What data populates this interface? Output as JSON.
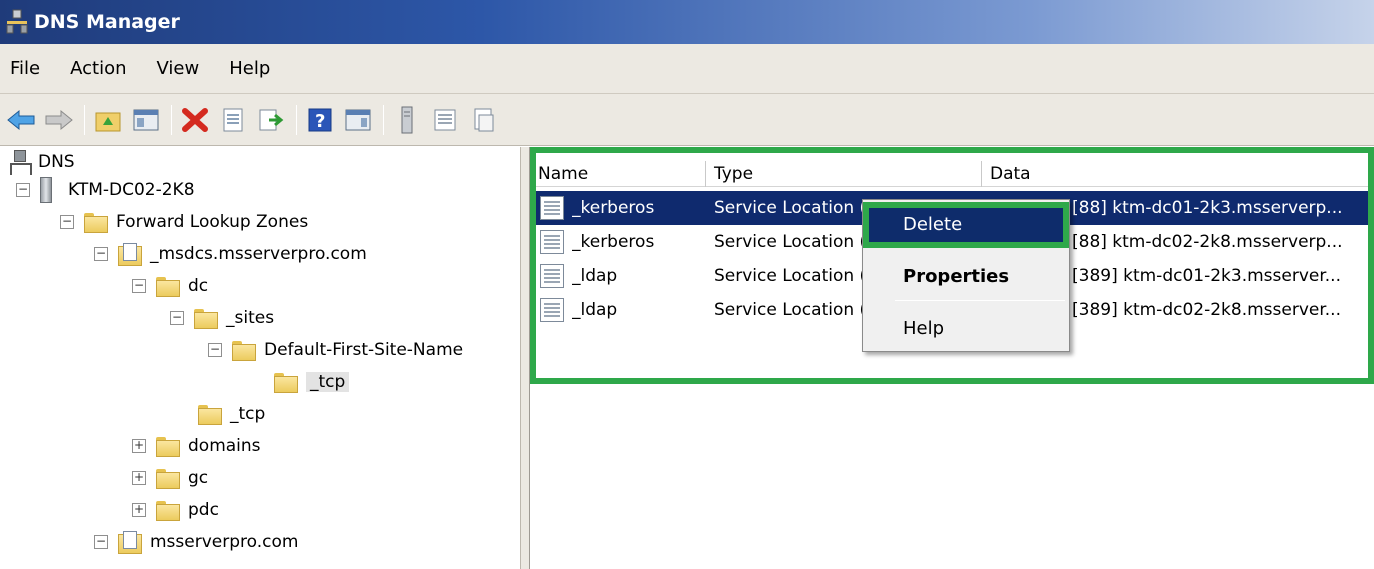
{
  "window": {
    "title": "DNS Manager"
  },
  "menu": [
    "File",
    "Action",
    "View",
    "Help"
  ],
  "toolbar": {
    "buttons": [
      "back-icon",
      "forward-icon",
      "up-folder-icon",
      "show-hide-tree-icon",
      "delete-icon",
      "properties-icon",
      "export-list-icon",
      "help-icon",
      "show-action-pane-icon",
      "server-icon",
      "list-icon",
      "filter-icon"
    ]
  },
  "tree": {
    "root": "DNS",
    "server": "KTM-DC02-2K8",
    "forward_zones": "Forward Lookup Zones",
    "msdcs_zone": "_msdcs.msserverpro.com",
    "dc": "dc",
    "sites": "_sites",
    "default_site": "Default-First-Site-Name",
    "tcp_selected": "_tcp",
    "tcp": "_tcp",
    "domains": "domains",
    "gc": "gc",
    "pdc": "pdc",
    "msserverpro_zone": "msserverpro.com"
  },
  "list": {
    "columns": [
      "Name",
      "Type",
      "Data"
    ],
    "rows": [
      {
        "name": "_kerberos",
        "type": "Service Location (SRV)",
        "data_prefix": "0 100",
        "data": "[88] ktm-dc01-2k3.msserverp..."
      },
      {
        "name": "_kerberos",
        "type": "Service Location (SRV)",
        "data_prefix": "",
        "data": "[88] ktm-dc02-2k8.msserverp..."
      },
      {
        "name": "_ldap",
        "type": "Service Location (SRV)",
        "data_prefix": "",
        "data": "[389] ktm-dc01-2k3.msserver..."
      },
      {
        "name": "_ldap",
        "type": "Service Location (SRV)",
        "data_prefix": "",
        "data": "[389] ktm-dc02-2k8.msserver..."
      }
    ]
  },
  "context_menu": {
    "delete": "Delete",
    "properties": "Properties",
    "help": "Help"
  },
  "colors": {
    "highlight": "#2ea84a",
    "selection": "#0f2a6e"
  }
}
